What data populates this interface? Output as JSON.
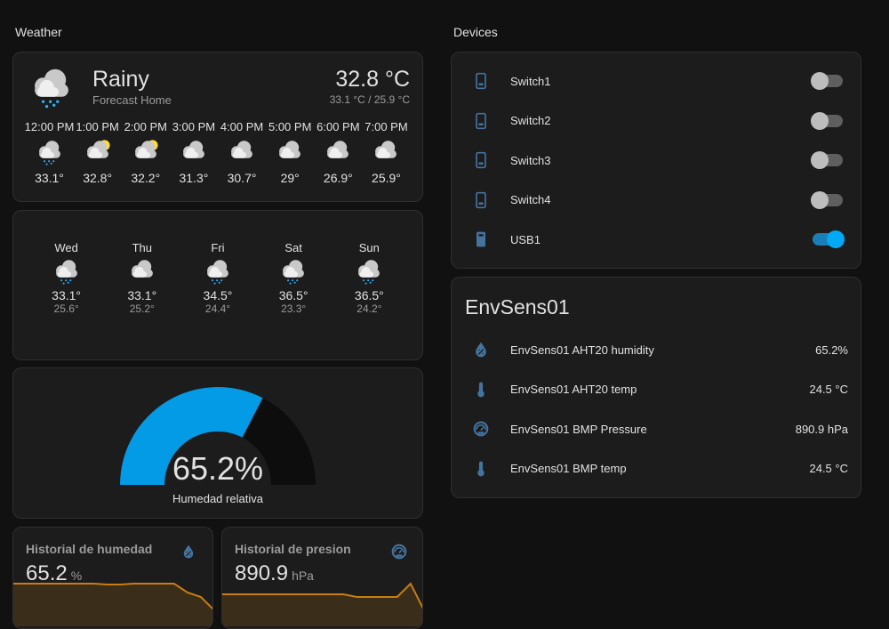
{
  "colors": {
    "accent": "#03a9f4",
    "icon": "#44739e",
    "graph": "#c97d12"
  },
  "weather": {
    "section_title": "Weather",
    "condition": "Rainy",
    "forecast_name": "Forecast Home",
    "temperature": "32.8 °C",
    "high_low": "33.1 °C / 25.9 °C",
    "hourly": [
      {
        "time": "12:00 PM",
        "icon": "rainy",
        "temp": "33.1°"
      },
      {
        "time": "1:00 PM",
        "icon": "partly-cloudy",
        "temp": "32.8°"
      },
      {
        "time": "2:00 PM",
        "icon": "partly-cloudy",
        "temp": "32.2°"
      },
      {
        "time": "3:00 PM",
        "icon": "cloudy",
        "temp": "31.3°"
      },
      {
        "time": "4:00 PM",
        "icon": "cloudy",
        "temp": "30.7°"
      },
      {
        "time": "5:00 PM",
        "icon": "cloudy",
        "temp": "29°"
      },
      {
        "time": "6:00 PM",
        "icon": "cloudy",
        "temp": "26.9°"
      },
      {
        "time": "7:00 PM",
        "icon": "cloudy",
        "temp": "25.9°"
      }
    ],
    "daily": [
      {
        "day": "Wed",
        "icon": "rainy",
        "high": "33.1°",
        "low": "25.6°"
      },
      {
        "day": "Thu",
        "icon": "cloudy",
        "high": "33.1°",
        "low": "25.2°"
      },
      {
        "day": "Fri",
        "icon": "rainy",
        "high": "34.5°",
        "low": "24.4°"
      },
      {
        "day": "Sat",
        "icon": "rainy",
        "high": "36.5°",
        "low": "23.3°"
      },
      {
        "day": "Sun",
        "icon": "rainy",
        "high": "36.5°",
        "low": "24.2°"
      }
    ]
  },
  "gauge": {
    "value": 65.2,
    "display": "65.2%",
    "label": "Humedad relativa",
    "min": 0,
    "max": 100
  },
  "history": [
    {
      "title": "Historial de humedad",
      "value": "65.2",
      "unit": "%",
      "icon": "water-percent-icon",
      "points": [
        65.5,
        65.5,
        65.5,
        65.5,
        65.5,
        65.5,
        65.5,
        65.4,
        65.4,
        65.5,
        65.5,
        65.5,
        65.5,
        64.5,
        64.0,
        62.5
      ]
    },
    {
      "title": "Historial de presion",
      "value": "890.9",
      "unit": "hPa",
      "icon": "gauge-icon",
      "points": [
        891.5,
        891.5,
        891.5,
        891.5,
        891.5,
        891.5,
        891.5,
        891.5,
        891.5,
        891.5,
        891.4,
        891.4,
        891.4,
        891.4,
        891.9,
        890.9
      ]
    }
  ],
  "devices": {
    "section_title": "Devices",
    "items": [
      {
        "name": "Switch1",
        "on": false,
        "icon": "phone"
      },
      {
        "name": "Switch2",
        "on": false,
        "icon": "phone"
      },
      {
        "name": "Switch3",
        "on": false,
        "icon": "phone"
      },
      {
        "name": "Switch4",
        "on": false,
        "icon": "phone"
      },
      {
        "name": "USB1",
        "on": true,
        "icon": "usb"
      }
    ]
  },
  "envsens": {
    "title": "EnvSens01",
    "items": [
      {
        "name": "EnvSens01 AHT20 humidity",
        "value": "65.2%",
        "icon": "humidity"
      },
      {
        "name": "EnvSens01 AHT20 temp",
        "value": "24.5 °C",
        "icon": "thermometer"
      },
      {
        "name": "EnvSens01 BMP Pressure",
        "value": "890.9 hPa",
        "icon": "gauge"
      },
      {
        "name": "EnvSens01 BMP temp",
        "value": "24.5 °C",
        "icon": "thermometer"
      }
    ]
  }
}
